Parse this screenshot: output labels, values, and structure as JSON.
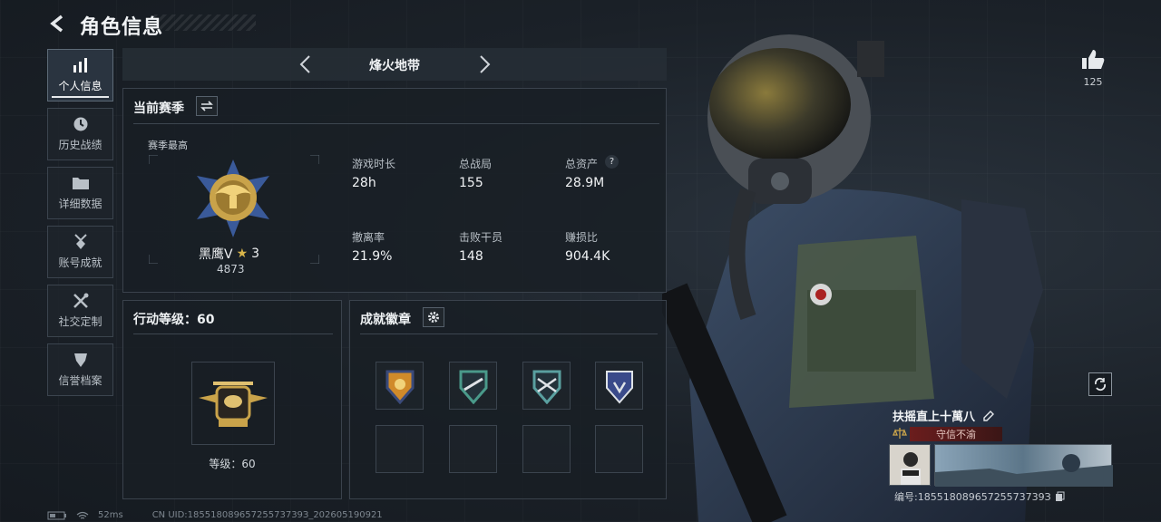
{
  "header": {
    "title": "角色信息"
  },
  "nav": {
    "items": [
      {
        "label": "个人信息",
        "icon": "bar-chart-icon",
        "active": true
      },
      {
        "label": "历史战绩",
        "icon": "clock-icon"
      },
      {
        "label": "详细数据",
        "icon": "folder-icon"
      },
      {
        "label": "账号成就",
        "icon": "medal-icon"
      },
      {
        "label": "社交定制",
        "icon": "tools-icon"
      },
      {
        "label": "信誉档案",
        "icon": "shield-badge-icon"
      }
    ]
  },
  "mode": {
    "label": "烽火地带"
  },
  "season": {
    "title": "当前赛季",
    "best_label": "赛季最高",
    "rank_name": "黑鹰V",
    "rank_stars": "3",
    "rank_score": "4873",
    "stats": [
      {
        "label": "游戏时长",
        "value": "28h"
      },
      {
        "label": "总战局",
        "value": "155"
      },
      {
        "label": "总资产",
        "value": "28.9M",
        "help": "?"
      },
      {
        "label": "撤离率",
        "value": "21.9%"
      },
      {
        "label": "击败干员",
        "value": "148"
      },
      {
        "label": "赚损比",
        "value": "904.4K"
      }
    ]
  },
  "action_level": {
    "title": "行动等级：60",
    "level_text": "等级：60"
  },
  "achievements": {
    "title": "成就徽章"
  },
  "profile": {
    "likes": "125",
    "name": "扶摇直上十萬八",
    "credit": "守信不渝",
    "serial": "编号:18551808965725573739З"
  },
  "status": {
    "ping": "52ms",
    "uid": "CN UID:18551808965725573739З_202605190921"
  },
  "colors": {
    "accent_red": "#6b1d1d",
    "panel_border": "#3a424c",
    "gold": "#c9a34a"
  }
}
